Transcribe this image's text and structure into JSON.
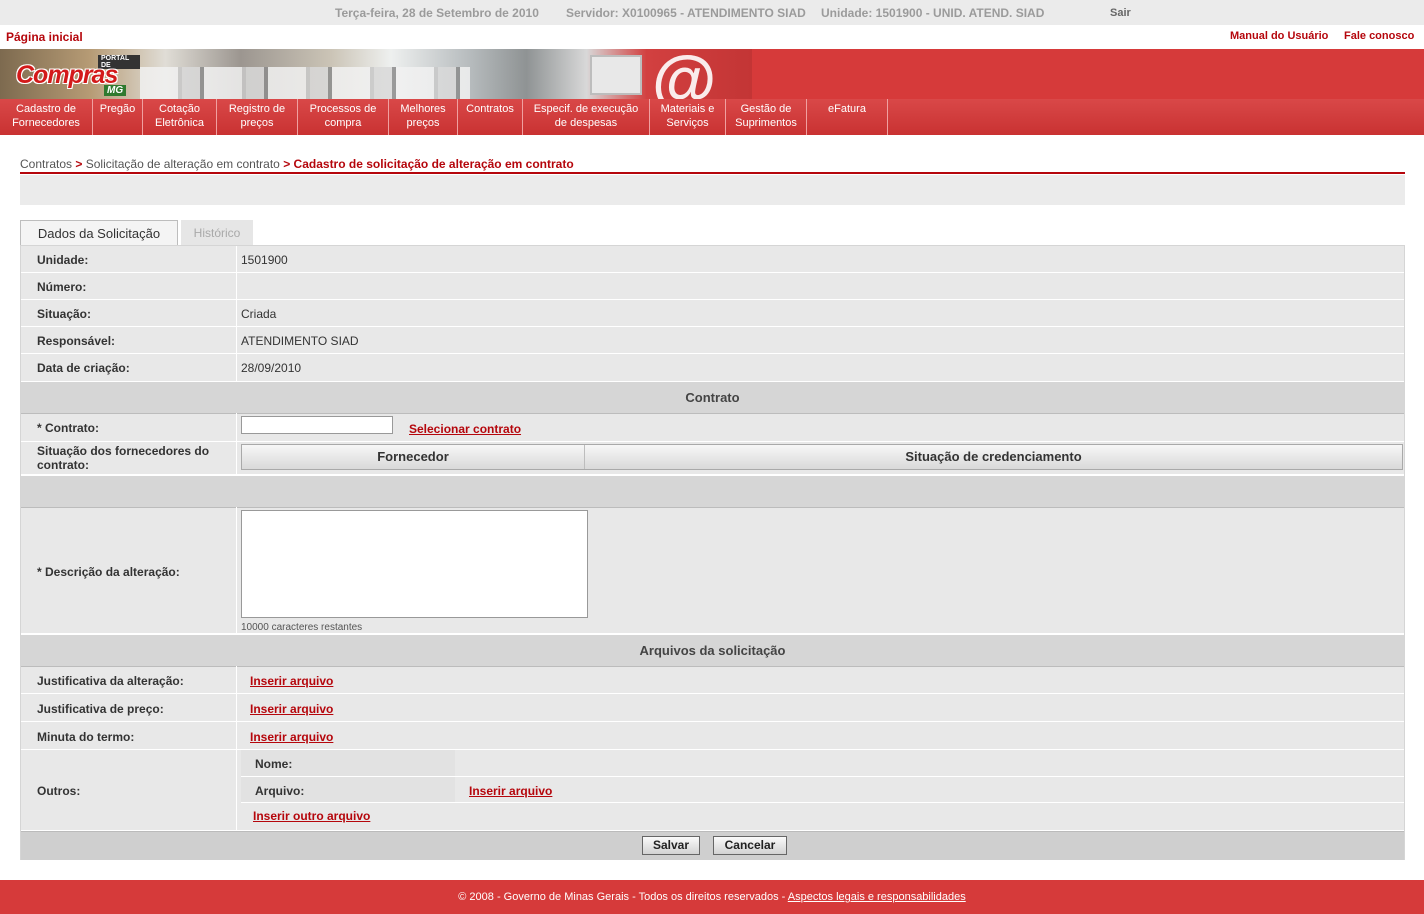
{
  "topbar": {
    "date": "Terça-feira, 28 de Setembro de 2010",
    "server": "Servidor: X0100965 - ATENDIMENTO SIAD",
    "unit": "Unidade: 1501900 - UNID. ATEND. SIAD",
    "logout": "Sair"
  },
  "links": {
    "home": "Página inicial",
    "manual": "Manual do Usuário",
    "contact": "Fale conosco"
  },
  "logo": {
    "portal": "PORTAL DE",
    "name": "Compras",
    "state": "MG"
  },
  "nav": [
    {
      "line1": "Cadastro de",
      "line2": "Fornecedores"
    },
    {
      "line1": "Pregão",
      "line2": ""
    },
    {
      "line1": "Cotação",
      "line2": "Eletrônica"
    },
    {
      "line1": "Registro de",
      "line2": "preços"
    },
    {
      "line1": "Processos de",
      "line2": "compra"
    },
    {
      "line1": "Melhores",
      "line2": "preços"
    },
    {
      "line1": "Contratos",
      "line2": ""
    },
    {
      "line1": "Especif. de execução",
      "line2": "de despesas"
    },
    {
      "line1": "Materiais e",
      "line2": "Serviços"
    },
    {
      "line1": "Gestão de",
      "line2": "Suprimentos"
    },
    {
      "line1": "eFatura",
      "line2": ""
    }
  ],
  "breadcrumb": {
    "item1": "Contratos",
    "item2": "Solicitação de alteração em contrato",
    "current": "Cadastro de solicitação de alteração em contrato",
    "separator": ">"
  },
  "tabs": {
    "active": "Dados da Solicitação",
    "inactive": "Histórico"
  },
  "details": {
    "unidade_label": "Unidade:",
    "unidade_value": "1501900",
    "numero_label": "Número:",
    "numero_value": "",
    "situacao_label": "Situação:",
    "situacao_value": "Criada",
    "responsavel_label": "Responsável:",
    "responsavel_value": "ATENDIMENTO SIAD",
    "data_label": "Data de criação:",
    "data_value": "28/09/2010"
  },
  "contrato": {
    "section_title": "Contrato",
    "contrato_label": "* Contrato:",
    "contrato_value": "",
    "select_link": "Selecionar contrato",
    "suppliers_label": "Situação dos fornecedores do contrato:",
    "col_supplier": "Fornecedor",
    "col_status": "Situação de credenciamento"
  },
  "descricao": {
    "label": "* Descrição da alteração:",
    "value": "",
    "remaining": "10000 caracteres restantes"
  },
  "arquivos": {
    "section_title": "Arquivos da solicitação",
    "just_alteracao_label": "Justificativa da alteração:",
    "just_preco_label": "Justificativa de preço:",
    "minuta_label": "Minuta do termo:",
    "outros_label": "Outros:",
    "nome_label": "Nome:",
    "arquivo_label": "Arquivo:",
    "insert_link": "Inserir arquivo",
    "insert_other_link": "Inserir outro arquivo"
  },
  "buttons": {
    "save": "Salvar",
    "cancel": "Cancelar"
  },
  "footer": {
    "text": "© 2008 - Governo de Minas Gerais - Todos os direitos reservados - ",
    "link": "Aspectos legais e responsabilidades"
  },
  "colors": {
    "brand_red": "#d63a3a",
    "link_red": "#b5060c",
    "panel_grey": "#e8e8e8"
  }
}
